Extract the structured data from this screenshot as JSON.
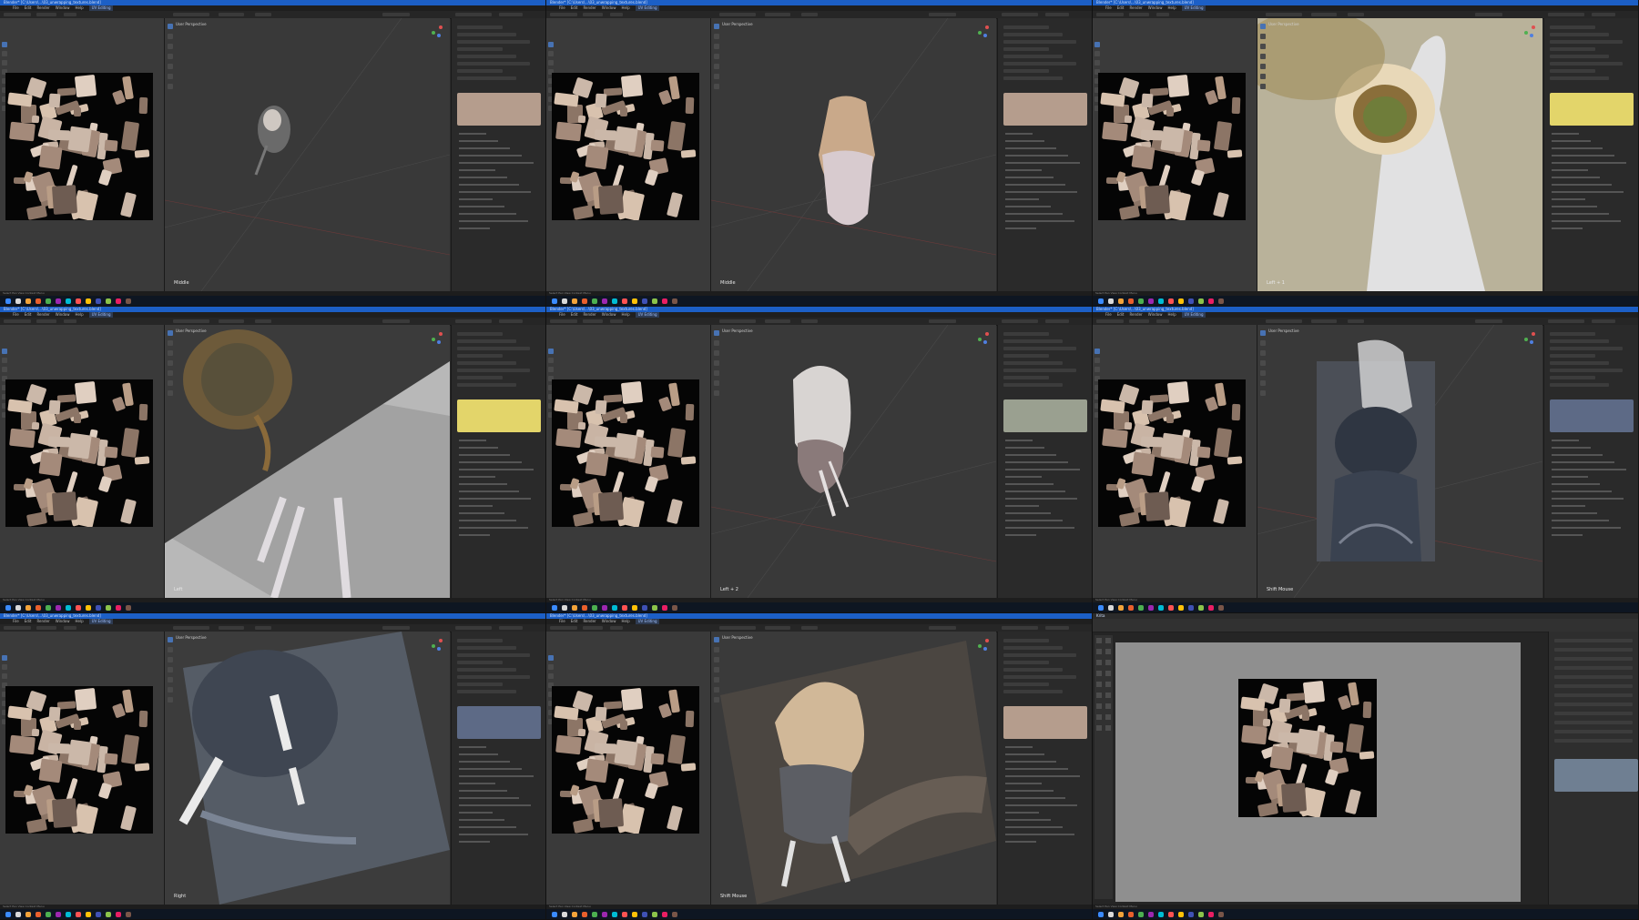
{
  "panels": [
    {
      "title": "Blender* [C:\\Users\\...\\03_unwrapping_textures.blend]",
      "viewport_label": "User Perspective",
      "viewport_mode": "Middle",
      "kind": "fly-body"
    },
    {
      "title": "Blender* [C:\\Users\\...\\03_unwrapping_textures.blend]",
      "viewport_label": "User Perspective",
      "viewport_mode": "Middle",
      "kind": "fly-body-front"
    },
    {
      "title": "Blender* [C:\\Users\\...\\03_unwrapping_textures.blend]",
      "viewport_label": "User Perspective",
      "viewport_mode": "Left + 1",
      "kind": "fly-eye"
    },
    {
      "title": "Blender* [C:\\Users\\...\\03_unwrapping_textures.blend]",
      "viewport_label": "User Perspective",
      "viewport_mode": "Left",
      "kind": "fly-legs"
    },
    {
      "title": "Blender* [C:\\Users\\...\\03_unwrapping_textures.blend]",
      "viewport_label": "User Perspective",
      "viewport_mode": "Left + 2",
      "kind": "body-side"
    },
    {
      "title": "Blender* [C:\\Users\\...\\03_unwrapping_textures.blend]",
      "viewport_label": "User Perspective",
      "viewport_mode": "Shift Mouse",
      "kind": "armor"
    },
    {
      "title": "Blender* [C:\\Users\\...\\03_unwrapping_textures.blend]",
      "viewport_label": "User Perspective",
      "viewport_mode": "Right",
      "kind": "armor-legs"
    },
    {
      "title": "Blender* [C:\\Users\\...\\03_unwrapping_textures.blend]",
      "viewport_label": "User Perspective",
      "viewport_mode": "Shift Mouse",
      "kind": "body-armor"
    },
    {
      "title": "Krita",
      "viewport_label": "",
      "viewport_mode": "",
      "kind": "krita"
    }
  ],
  "menu": [
    "File",
    "Edit",
    "Render",
    "Window",
    "Help"
  ],
  "workspace": "UV Editing",
  "status_text": "Select   Pan View   Context Menu",
  "clock": {
    "time": "",
    "date": ""
  },
  "colors": {
    "title_blue": "#1c5fc6",
    "accent": "#4772b3",
    "uv_bg": "#3a3a3a",
    "viewport_bg": "#393939"
  },
  "icons": [
    "windows-start-icon",
    "search-icon",
    "browser-icon",
    "blender-icon",
    "folder-icon"
  ]
}
